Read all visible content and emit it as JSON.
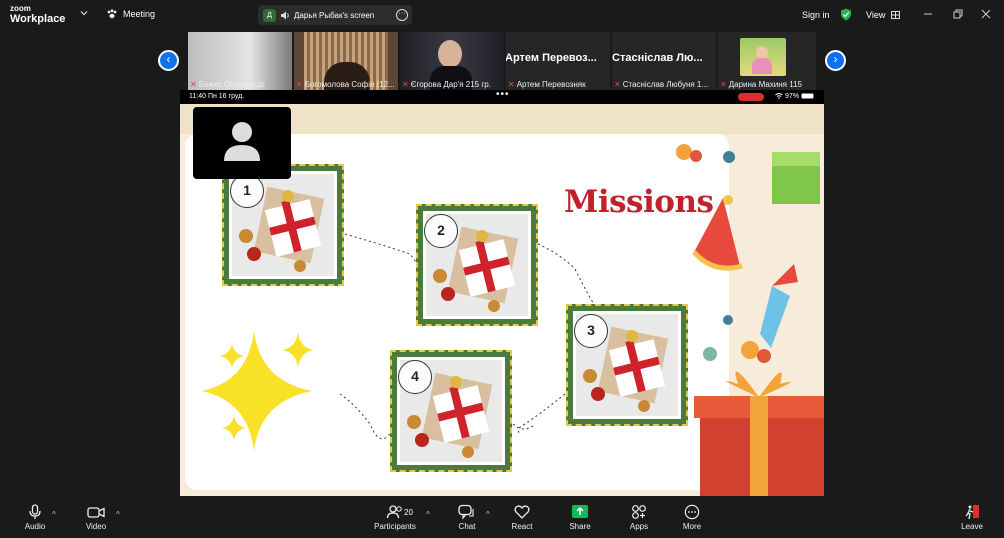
{
  "app": {
    "brand_line1": "zoom",
    "brand_line2": "Workplace",
    "meeting_label": "Meeting"
  },
  "share": {
    "badge": "Д",
    "label": "Дарья Рыбак's screen"
  },
  "topright": {
    "sign_in": "Sign in",
    "view": "View"
  },
  "participants_strip": [
    {
      "name": "Божко Олександр"
    },
    {
      "name": "Богомолова Софія (12..."
    },
    {
      "name": "Єгорова Дар'я 215 гр."
    },
    {
      "name": "Артем Перевозняк",
      "display_name": "Артем Перевоз..."
    },
    {
      "name": "Стасніслав Любуня 1...",
      "display_name": "Стасніслав Лю..."
    },
    {
      "name": "Дарина Махиня 115"
    }
  ],
  "phone_status": {
    "time": "11:40  Пн 16 груд.",
    "battery": "97%"
  },
  "slide": {
    "title": "Missions",
    "missions": [
      "1",
      "2",
      "3",
      "4"
    ]
  },
  "toolbar": {
    "audio": "Audio",
    "video": "Video",
    "participants": "Participants",
    "participants_count": "20",
    "chat": "Chat",
    "react": "React",
    "share": "Share",
    "apps": "Apps",
    "more": "More",
    "leave": "Leave"
  },
  "colors": {
    "accent_blue": "#0e72ed",
    "share_green": "#0dbb5a",
    "mission_red": "#c0222c",
    "frame_green": "#4a7a3c"
  }
}
